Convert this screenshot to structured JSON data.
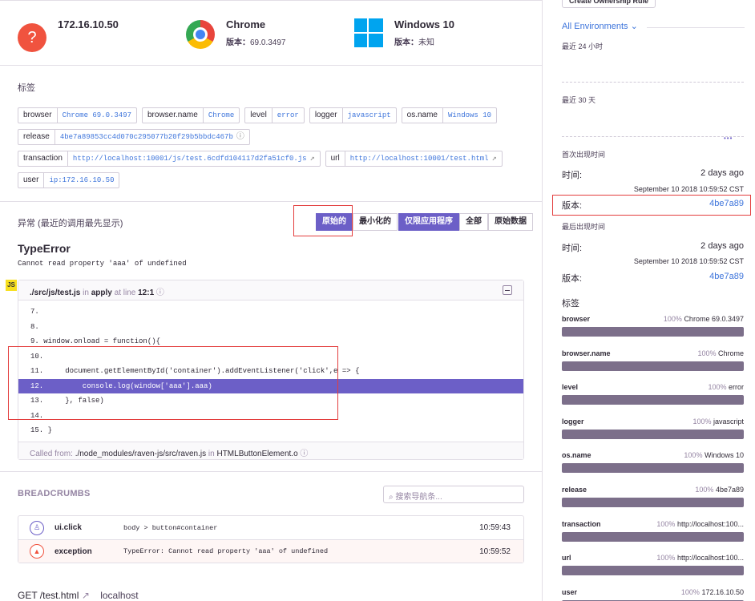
{
  "context": {
    "user": {
      "icon": "?",
      "title": "172.16.10.50"
    },
    "browser": {
      "title": "Chrome",
      "version_label": "版本：",
      "version": "69.0.3497"
    },
    "os": {
      "title": "Windows 10",
      "version_label": "版本：",
      "version": "未知"
    }
  },
  "tags": {
    "title": "标签",
    "rows": [
      [
        {
          "key": "browser",
          "value": "Chrome 69.0.3497"
        },
        {
          "key": "browser.name",
          "value": "Chrome"
        },
        {
          "key": "level",
          "value": "error"
        },
        {
          "key": "logger",
          "value": "javascript"
        },
        {
          "key": "os.name",
          "value": "Windows 10"
        }
      ],
      [
        {
          "key": "release",
          "value": "4be7a89853cc4d070c295077b20f29b5bbdc467b",
          "ext": "ⓘ"
        }
      ],
      [
        {
          "key": "transaction",
          "value": "http://localhost:10001/js/test.6cdfd104117d2fa51cf0.js",
          "ext": "↗"
        },
        {
          "key": "url",
          "value": "http://localhost:10001/test.html",
          "ext": "↗"
        }
      ],
      [
        {
          "key": "user",
          "value": "ip:172.16.10.50"
        }
      ]
    ]
  },
  "exception": {
    "header": "异常 (最近的调用最先显示)",
    "buttons_left": [
      "原始的",
      "最小化的"
    ],
    "buttons_right": [
      "仅限应用程序",
      "全部",
      "原始数据"
    ],
    "type": "TypeError",
    "message": "Cannot read property 'aaa' of undefined",
    "badge": "JS",
    "frame": {
      "file": "./src/js/test.js",
      "in": "in",
      "func": "apply",
      "at_line": "at line",
      "line": "12:1",
      "help": "ⓘ",
      "lines": [
        "7.",
        "8.",
        "9. window.onload = function(){",
        "10.",
        "11.     document.getElementById('container').addEventListener('click',e => {",
        "12.         console.log(window['aaa'].aaa)",
        "13.     }, false)",
        "14.",
        "15. }"
      ],
      "called_from_label": "Called from:",
      "called_from": "./node_modules/raven-js/src/raven.js",
      "called_in": "in",
      "called_func": "HTMLButtonElement.o",
      "called_help": "ⓘ"
    }
  },
  "breadcrumbs": {
    "title": "BREADCRUMBS",
    "search_placeholder": "搜索导航条...",
    "items": [
      {
        "icon": "♙",
        "category": "ui.click",
        "message": "body > button#container",
        "time": "10:59:43"
      },
      {
        "icon": "▲",
        "category": "exception",
        "message": "TypeError: Cannot read property 'aaa' of undefined",
        "time": "10:59:52"
      }
    ]
  },
  "request": {
    "method_path": "GET /test.html",
    "ext": "↗",
    "host": "localhost"
  },
  "sidebar": {
    "ownership_button": "Create Ownership Rule",
    "env": "All Environments",
    "last24": "最近 24 小时",
    "last30": "最近 30 天",
    "first_seen": "首次出现时间",
    "last_seen": "最后出现时间",
    "time_label": "时间:",
    "version_label": "版本:",
    "first": {
      "time": "2 days ago",
      "date": "September 10 2018 10:59:52 CST",
      "version": "4be7a89"
    },
    "last": {
      "time": "2 days ago",
      "date": "September 10 2018 10:59:52 CST",
      "version": "4be7a89"
    },
    "tags_title": "标签",
    "tags": [
      {
        "key": "browser",
        "pct": "100%",
        "value": "Chrome 69.0.3497"
      },
      {
        "key": "browser.name",
        "pct": "100%",
        "value": "Chrome"
      },
      {
        "key": "level",
        "pct": "100%",
        "value": "error"
      },
      {
        "key": "logger",
        "pct": "100%",
        "value": "javascript"
      },
      {
        "key": "os.name",
        "pct": "100%",
        "value": "Windows 10"
      },
      {
        "key": "release",
        "pct": "100%",
        "value": "4be7a89"
      },
      {
        "key": "transaction",
        "pct": "100%",
        "value": "http://localhost:100..."
      },
      {
        "key": "url",
        "pct": "100%",
        "value": "http://localhost:100..."
      },
      {
        "key": "user",
        "pct": "100%",
        "value": "172.16.10.50"
      }
    ]
  },
  "colors": {
    "accent": "#6c5fc7",
    "link": "#3d74db",
    "error": "#f0533f",
    "annotation": "#e33e3e"
  }
}
